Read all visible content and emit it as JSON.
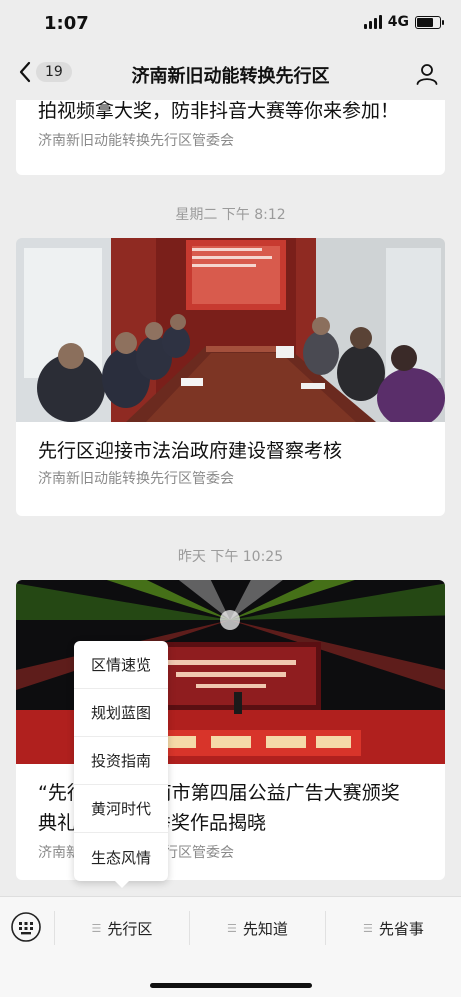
{
  "status_bar": {
    "time": "1:07",
    "network": "4G",
    "battery_level": 0.75
  },
  "nav": {
    "back_count": "19",
    "title": "济南新旧动能转换先行区"
  },
  "feed": {
    "items": [
      {
        "title": "拍视频拿大奖，防非抖音大赛等你来参加！",
        "source": "济南新旧动能转换先行区管委会"
      },
      {
        "timestamp": "星期二 下午 8:12",
        "title": "先行区迎接市法治政府建设督察考核",
        "source": "济南新旧动能转换先行区管委会",
        "image": "meeting-photo"
      },
      {
        "timestamp": "昨天 下午 10:25",
        "title_line1": "“先行区”在济南市第四届公益广告大赛颁奖",
        "title_line2": "典礼上获得优秀奖作品揭晓",
        "source": "济南新旧动能转换先行区管委会",
        "image": "stage-photo"
      }
    ]
  },
  "popup_menu": {
    "items": [
      "区情速览",
      "规划蓝图",
      "投资指南",
      "黄河时代",
      "生态风情"
    ]
  },
  "bottom_menu": {
    "tabs": [
      "先行区",
      "先知道",
      "先省事"
    ]
  },
  "colors": {
    "background": "#ededed",
    "card": "#ffffff",
    "stage_red": "#b0201e"
  }
}
